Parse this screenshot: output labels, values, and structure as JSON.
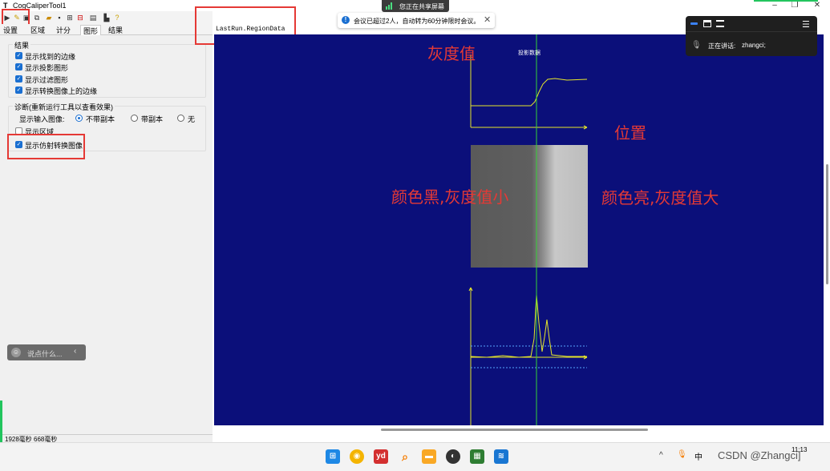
{
  "window": {
    "title": "CogCaliperTool1",
    "icon_glyph": "T"
  },
  "tabs": [
    {
      "label": "设置"
    },
    {
      "label": "区域"
    },
    {
      "label": "计分"
    },
    {
      "label": "图形"
    },
    {
      "label": "结果"
    }
  ],
  "results_group": {
    "title": "结果",
    "items": [
      {
        "label": "显示找到的边缘",
        "checked": true
      },
      {
        "label": "显示投影图形",
        "checked": true
      },
      {
        "label": "显示过滤图形",
        "checked": true
      },
      {
        "label": "显示转换图像上的边缘",
        "checked": true
      }
    ]
  },
  "diagnostics_group": {
    "title": "诊断(重新运行工具以查看效果)",
    "input_image_label": "显示输入图像:",
    "radio_options": [
      {
        "label": "不带副本",
        "selected": true
      },
      {
        "label": "带副本",
        "selected": false
      },
      {
        "label": "无",
        "selected": false
      }
    ],
    "show_region_label": "显示区域",
    "show_region_checked": false,
    "show_affine_label": "显示仿射转换图像",
    "show_affine_checked": true
  },
  "chat": {
    "placeholder": "说点什么..."
  },
  "status": {
    "text": "1928毫秒 668毫秒"
  },
  "viewer": {
    "title": "LastRun.RegionData",
    "projection_label": "投影数据"
  },
  "annotations": {
    "gray_value": "灰度值",
    "position": "位置",
    "dark_small": "颜色黑,灰度值小",
    "bright_large": "颜色亮,灰度值大"
  },
  "share_banner": {
    "text": "您正在共享屏幕"
  },
  "meeting_toast": {
    "text": "会议已超过2人，自动转为60分钟限时会议。"
  },
  "meet_panel": {
    "speaking_label": "正在讲话:",
    "speaker": "zhangci;"
  },
  "taskbar": {
    "tray_text": "中",
    "clock_time": "11:13",
    "watermark": "CSDN @Zhangci]"
  },
  "colors": {
    "canvas_bg": "#0b0f7a",
    "curve": "#e6e62a",
    "center_line": "#35d035",
    "dashed": "#55a6ff",
    "annotation_red": "#e53935",
    "checkbox_blue": "#1a6fd1"
  },
  "icons": {
    "toolbar": [
      "run-icon",
      "edit-icon",
      "image-icon",
      "copy-icon",
      "open-icon",
      "save-icon",
      "link-icon",
      "grid-icon",
      "display-icon",
      "chart-icon",
      "help-icon"
    ]
  }
}
